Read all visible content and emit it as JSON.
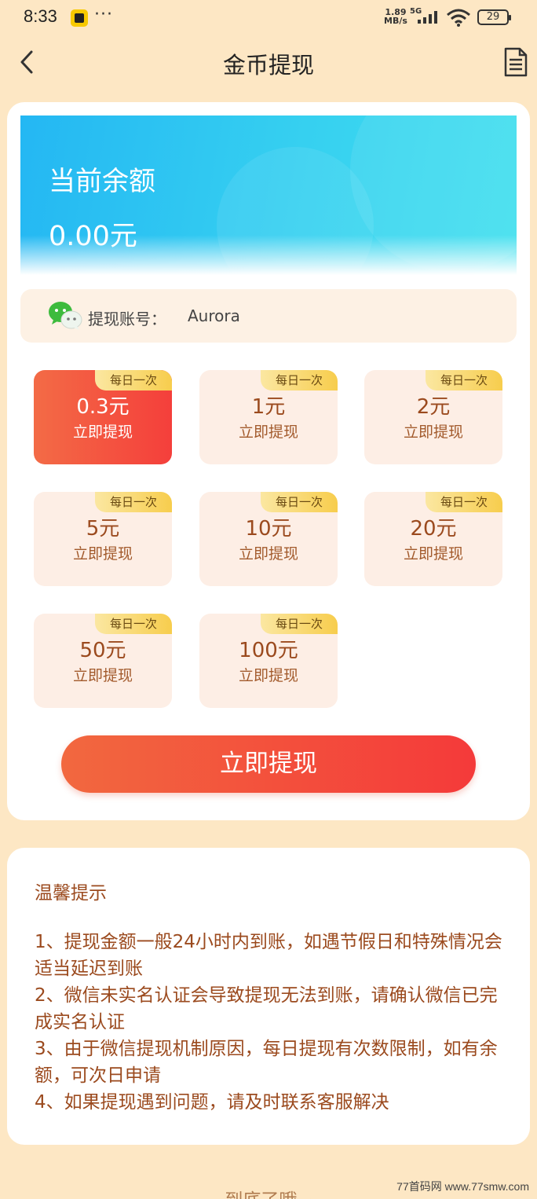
{
  "status_bar": {
    "time": "8:33",
    "dots": "···",
    "net_speed_line1": "1.89",
    "net_speed_line2": "MB/s",
    "network": "5G",
    "battery": "29"
  },
  "header": {
    "title": "金币提现",
    "back_icon": "chevron-left-icon",
    "record_icon": "document-icon"
  },
  "balance": {
    "label": "当前余额",
    "value": "0.00元"
  },
  "account": {
    "icon": "wechat-icon",
    "label": "提现账号：",
    "value": "Aurora"
  },
  "amounts": [
    {
      "amount": "0.3元",
      "action": "立即提现",
      "badge": "每日一次",
      "selected": true
    },
    {
      "amount": "1元",
      "action": "立即提现",
      "badge": "每日一次",
      "selected": false
    },
    {
      "amount": "2元",
      "action": "立即提现",
      "badge": "每日一次",
      "selected": false
    },
    {
      "amount": "5元",
      "action": "立即提现",
      "badge": "每日一次",
      "selected": false
    },
    {
      "amount": "10元",
      "action": "立即提现",
      "badge": "每日一次",
      "selected": false
    },
    {
      "amount": "20元",
      "action": "立即提现",
      "badge": "每日一次",
      "selected": false
    },
    {
      "amount": "50元",
      "action": "立即提现",
      "badge": "每日一次",
      "selected": false
    },
    {
      "amount": "100元",
      "action": "立即提现",
      "badge": "每日一次",
      "selected": false
    }
  ],
  "withdraw_button": "立即提现",
  "tips": {
    "title": "温馨提示",
    "items": [
      "1、提现金额一般24小时内到账，如遇节假日和特殊情况会适当延迟到账",
      "2、微信未实名认证会导致提现无法到账，请确认微信已完成实名认证",
      "3、由于微信提现机制原因，每日提现有次数限制，如有余额，可次日申请",
      "4、如果提现遇到问题，请及时联系客服解决"
    ]
  },
  "footer": "- 到底了哦~ -",
  "watermark": "77首码网 www.77smw.com",
  "colors": {
    "page_bg": "#fde7c4",
    "accent_start": "#f2683f",
    "accent_end": "#f43a3a",
    "banner": "#2ec4f2",
    "text_brown": "#9b4a1e"
  }
}
